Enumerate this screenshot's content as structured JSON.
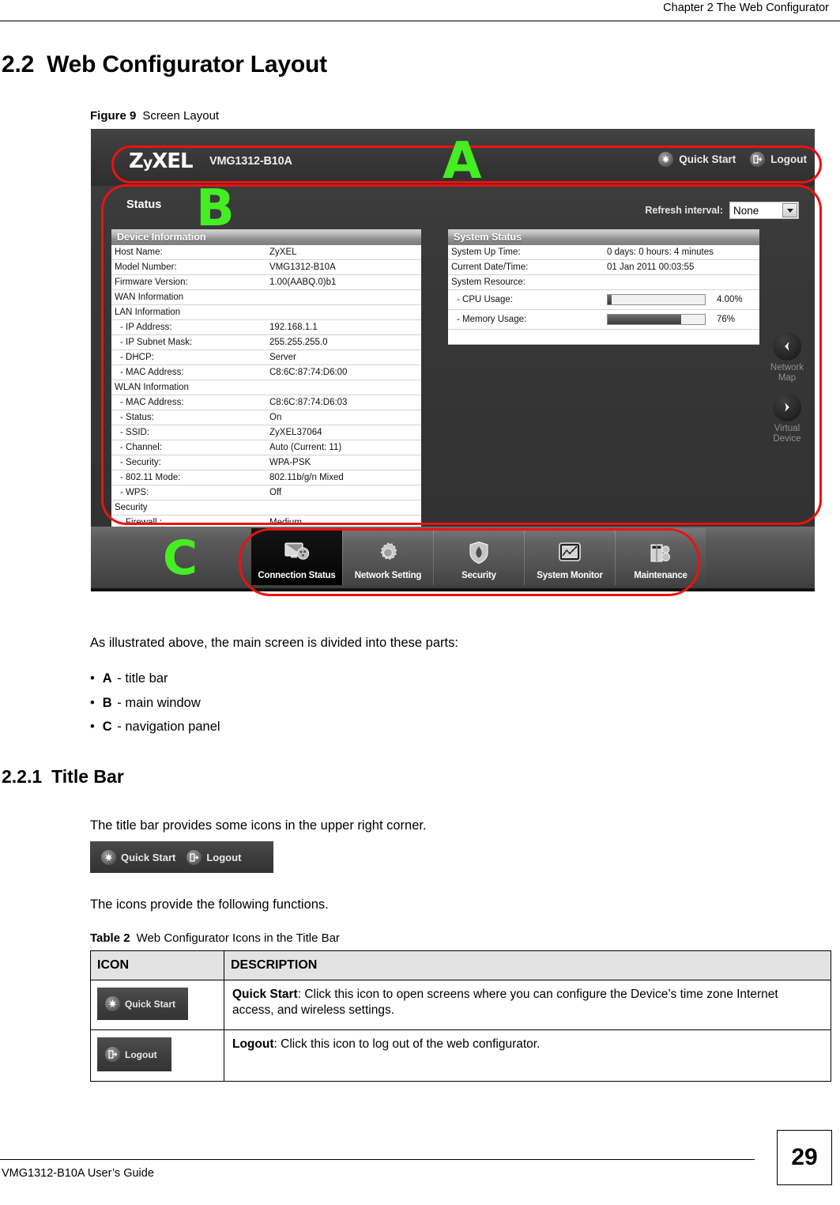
{
  "page": {
    "running_header": "Chapter 2 The Web Configurator",
    "footer_text": "VMG1312-B10A User’s Guide",
    "page_number": "29"
  },
  "headings": {
    "h2_number": "2.2",
    "h2_title": "Web Configurator Layout",
    "h3_number": "2.2.1",
    "h3_title": "Title Bar"
  },
  "figure": {
    "caption_label": "Figure 9",
    "caption_title": "Screen Layout",
    "annotations": [
      {
        "letter": "A",
        "meaning": "title bar"
      },
      {
        "letter": "B",
        "meaning": "main window"
      },
      {
        "letter": "C",
        "meaning": "navigation panel"
      }
    ],
    "titlebar": {
      "logo": "ZyXEL",
      "model": "VMG1312-B10A",
      "actions": [
        {
          "icon": "quick-start-icon",
          "label": "Quick Start"
        },
        {
          "icon": "logout-icon",
          "label": "Logout"
        }
      ]
    },
    "main": {
      "screen_label": "Status",
      "refresh_label": "Refresh interval:",
      "refresh_value": "None",
      "panels": [
        {
          "title": "Device Information",
          "rows": [
            {
              "key": "Host Name:",
              "value": "ZyXEL",
              "indent": false
            },
            {
              "key": "Model Number:",
              "value": "VMG1312-B10A",
              "indent": false
            },
            {
              "key": "Firmware Version:",
              "value": "1.00(AABQ.0)b1",
              "indent": false
            },
            {
              "key": "WAN Information",
              "value": "",
              "indent": false
            },
            {
              "key": "LAN Information",
              "value": "",
              "indent": false
            },
            {
              "key": "- IP Address:",
              "value": "192.168.1.1",
              "indent": true
            },
            {
              "key": "- IP Subnet Mask:",
              "value": "255.255.255.0",
              "indent": true
            },
            {
              "key": "- DHCP:",
              "value": "Server",
              "indent": true
            },
            {
              "key": "- MAC Address:",
              "value": "C8:6C:87:74:D6:00",
              "indent": true
            },
            {
              "key": "WLAN Information",
              "value": "",
              "indent": false
            },
            {
              "key": "- MAC Address:",
              "value": "C8:6C:87:74:D6:03",
              "indent": true
            },
            {
              "key": "- Status:",
              "value": "On",
              "indent": true
            },
            {
              "key": "- SSID:",
              "value": "ZyXEL37064",
              "indent": true
            },
            {
              "key": "- Channel:",
              "value": "Auto (Current: 11)",
              "indent": true
            },
            {
              "key": "- Security:",
              "value": "WPA-PSK",
              "indent": true
            },
            {
              "key": "- 802.11 Mode:",
              "value": "802.11b/g/n Mixed",
              "indent": true
            },
            {
              "key": "- WPS:",
              "value": "Off",
              "indent": true
            },
            {
              "key": "Security",
              "value": "",
              "indent": false
            },
            {
              "key": "- Firewall :",
              "value": "Medium",
              "indent": true
            }
          ]
        },
        {
          "title": "System Status",
          "rows": [
            {
              "key": "System Up Time:",
              "value": "0 days: 0 hours: 4 minutes",
              "indent": false
            },
            {
              "key": "Current Date/Time:",
              "value": "01 Jan 2011 00:03:55",
              "indent": false
            },
            {
              "key": "System Resource:",
              "value": "",
              "indent": false
            }
          ],
          "meters": [
            {
              "key": "- CPU Usage:",
              "value": "4.00%",
              "percent": 4
            },
            {
              "key": "- Memory Usage:",
              "value": "76%",
              "percent": 76
            }
          ]
        }
      ],
      "side_buttons": [
        {
          "icon": "chevron-left-icon",
          "label_line1": "Network",
          "label_line2": "Map"
        },
        {
          "icon": "chevron-right-icon",
          "label_line1": "Virtual",
          "label_line2": "Device"
        }
      ]
    },
    "nav": {
      "items": [
        {
          "icon": "monitor-icon",
          "label": "Connection Status",
          "active": true
        },
        {
          "icon": "gear-icon",
          "label": "Network Setting",
          "active": false
        },
        {
          "icon": "shield-icon",
          "label": "Security",
          "active": false
        },
        {
          "icon": "chart-icon",
          "label": "System Monitor",
          "active": false
        },
        {
          "icon": "toolbox-icon",
          "label": "Maintenance",
          "active": false
        }
      ]
    }
  },
  "body": {
    "intro": "As illustrated above, the main screen is divided into these parts:",
    "bullets": [
      {
        "letter": "A",
        "text": "- title bar"
      },
      {
        "letter": "B",
        "text": "- main window"
      },
      {
        "letter": "C",
        "text": "- navigation panel"
      }
    ],
    "titlebar_para": "The title bar provides some icons in the upper right corner.",
    "icons_para": "The icons provide the following functions.",
    "sample_titlebar": {
      "quick_start_label": "Quick Start",
      "logout_label": "Logout"
    }
  },
  "table2": {
    "caption_label": "Table 2",
    "caption_title": "Web Configurator Icons in the Title Bar",
    "headers": [
      "ICON",
      "DESCRIPTION"
    ],
    "rows": [
      {
        "icon_label": "Quick Start",
        "icon_name": "quick-start-icon",
        "term": "Quick Start",
        "description": ": Click this icon to open screens where you can configure the Device’s time zone Internet access, and wireless settings."
      },
      {
        "icon_label": "Logout",
        "icon_name": "logout-icon",
        "term": "Logout",
        "description": ": Click this icon to log out of the web configurator."
      }
    ]
  },
  "colors": {
    "annotation_red": "#ee1111",
    "annotation_green": "#44ee22",
    "ui_dark": "#2f2f2f",
    "table_header_bg": "#e3e3e3"
  }
}
